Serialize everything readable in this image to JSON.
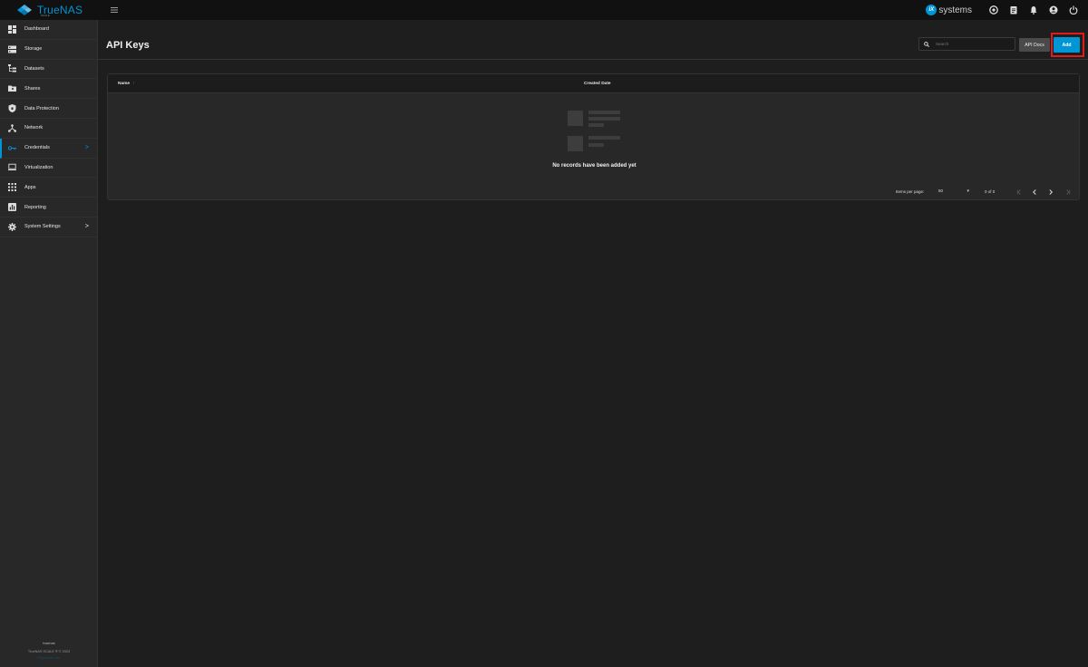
{
  "brand": {
    "name": "TrueNAS",
    "edition": "SCALE"
  },
  "topbar": {
    "vendor_badge": "iX",
    "vendor_text": "systems",
    "icons": [
      "truecommand-icon",
      "clipboard-icon",
      "bell-icon",
      "account-icon",
      "power-icon"
    ]
  },
  "sidebar": {
    "items": [
      {
        "label": "Dashboard",
        "icon": "dashboard-icon"
      },
      {
        "label": "Storage",
        "icon": "storage-icon"
      },
      {
        "label": "Datasets",
        "icon": "datasets-icon"
      },
      {
        "label": "Shares",
        "icon": "folder-icon"
      },
      {
        "label": "Data Protection",
        "icon": "shield-icon"
      },
      {
        "label": "Network",
        "icon": "network-icon"
      },
      {
        "label": "Credentials",
        "icon": "key-icon",
        "active": true,
        "chevron": ">"
      },
      {
        "label": "Virtualization",
        "icon": "monitor-icon"
      },
      {
        "label": "Apps",
        "icon": "apps-icon"
      },
      {
        "label": "Reporting",
        "icon": "chart-icon"
      },
      {
        "label": "System Settings",
        "icon": "gear-icon",
        "chevron": ">"
      }
    ],
    "footer": {
      "hostname": "truenas",
      "copyright": "TrueNAS SCALE ® © 2023",
      "company": "iXsystems, Inc."
    }
  },
  "page": {
    "title": "API Keys",
    "search_placeholder": "Search",
    "docs_label": "API Docs",
    "add_label": "Add"
  },
  "table": {
    "columns": {
      "name": "Name",
      "sort_indicator": "↑",
      "created": "Created Date"
    },
    "empty_message": "No records have been added yet"
  },
  "paginator": {
    "label": "Items per page:",
    "page_size": "50",
    "range": "0 of 0"
  },
  "colors": {
    "accent": "#0095d5",
    "highlight": "#e01b1b",
    "background": "#1e1e1e",
    "sidebar": "#282828"
  }
}
